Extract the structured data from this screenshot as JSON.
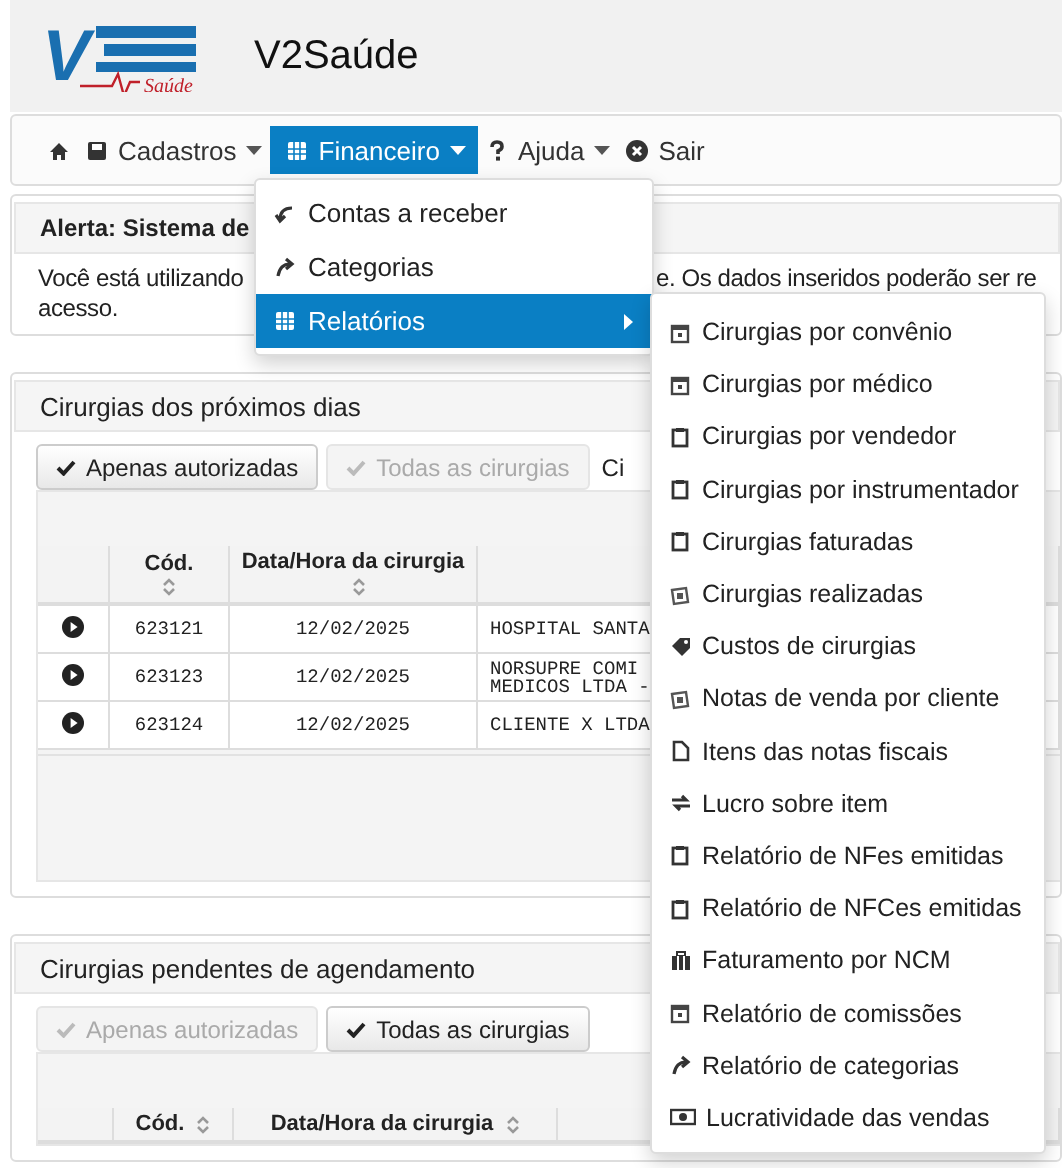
{
  "logo": {
    "mark": "V",
    "sub": "Saúde"
  },
  "app_title": "V2Saúde",
  "navbar": [
    {
      "kind": "home",
      "selected": false,
      "caret": false
    },
    {
      "kind": "save",
      "label": "Cadastros",
      "selected": false,
      "caret": true
    },
    {
      "kind": "grid",
      "label": "Financeiro",
      "selected": true,
      "caret": true
    },
    {
      "kind": "help",
      "label": "Ajuda",
      "selected": false,
      "caret": true
    },
    {
      "kind": "exit",
      "label": "Sair",
      "selected": false,
      "caret": false
    }
  ],
  "dropdown": [
    {
      "label": "Contas a receber",
      "selected": false,
      "submenu": false
    },
    {
      "label": "Categorias",
      "selected": false,
      "submenu": false
    },
    {
      "label": "Relatórios",
      "selected": true,
      "submenu": true
    }
  ],
  "submenu": [
    "Cirurgias por convênio",
    "Cirurgias por médico",
    "Cirurgias por vendedor",
    "Cirurgias por instrumentador",
    "Cirurgias faturadas",
    "Cirurgias realizadas",
    "Custos de cirurgias",
    "Notas de venda por cliente",
    "Itens das notas fiscais",
    "Lucro sobre item",
    "Relatório de NFes emitidas",
    "Relatório de NFCes emitidas",
    "Faturamento por NCM",
    "Relatório de comissões",
    "Relatório de categorias",
    "Lucratividade das vendas"
  ],
  "alert": {
    "title": "Alerta: Sistema de",
    "line_1_start": "Você está utilizando",
    "line_1_end": "e. Os dados inseridos poderão ser re",
    "line_2": "acesso."
  },
  "sections": [
    {
      "title": "Cirurgias dos próximos dias",
      "filters": [
        {
          "label": "Apenas autorizadas",
          "disabled": false
        },
        {
          "label": "Todas as cirurgias",
          "disabled": true
        }
      ],
      "filter_extra": "Ci",
      "columns": [
        "Cód.",
        "Data/Hora da cirurgia"
      ],
      "wrap_header": true,
      "rows": [
        [
          "623121",
          "12/02/2025",
          "HOSPITAL SANTA"
        ],
        [
          "623123",
          "12/02/2025",
          "NORSUPRE COMI\nMEDICOS LTDA -"
        ],
        [
          "623124",
          "12/02/2025",
          "CLIENTE X LTDA"
        ]
      ]
    },
    {
      "title": "Cirurgias pendentes de agendamento",
      "filters": [
        {
          "label": "Apenas autorizadas",
          "disabled": true
        },
        {
          "label": "Todas as cirurgias",
          "disabled": false
        }
      ],
      "columns": [
        "Cód.",
        "Data/Hora da cirurgia"
      ],
      "wrap_header": false
    }
  ]
}
